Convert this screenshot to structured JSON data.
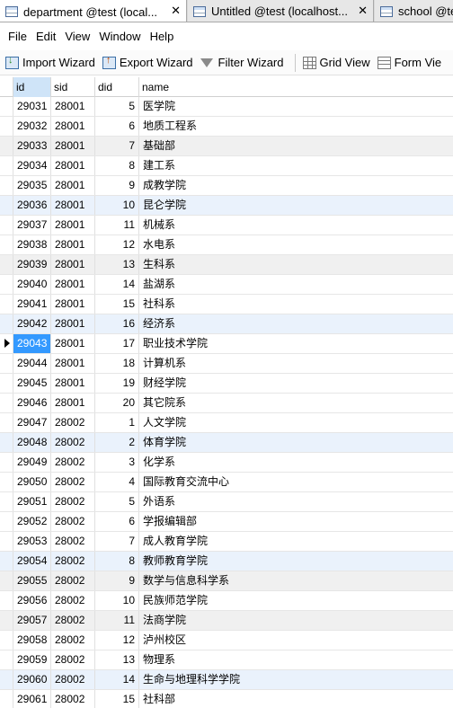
{
  "tabs": [
    {
      "label": "department @test (local...",
      "close": "✕"
    },
    {
      "label": "Untitled @test (localhost...",
      "close": "✕"
    },
    {
      "label": "school @te",
      "close": ""
    }
  ],
  "menu": [
    "File",
    "Edit",
    "View",
    "Window",
    "Help"
  ],
  "toolbar": {
    "import_wizard": "Import Wizard",
    "export_wizard": "Export Wizard",
    "filter_wizard": "Filter Wizard",
    "grid_view": "Grid View",
    "form_view": "Form Vie"
  },
  "columns": [
    "id",
    "sid",
    "did",
    "name"
  ],
  "selected_row_id": "29043",
  "rows": [
    {
      "id": "29031",
      "sid": "28001",
      "did": "5",
      "name": "医学院"
    },
    {
      "id": "29032",
      "sid": "28001",
      "did": "6",
      "name": "地质工程系"
    },
    {
      "id": "29033",
      "sid": "28001",
      "did": "7",
      "name": "基础部"
    },
    {
      "id": "29034",
      "sid": "28001",
      "did": "8",
      "name": "建工系"
    },
    {
      "id": "29035",
      "sid": "28001",
      "did": "9",
      "name": "成教学院"
    },
    {
      "id": "29036",
      "sid": "28001",
      "did": "10",
      "name": "昆仑学院"
    },
    {
      "id": "29037",
      "sid": "28001",
      "did": "11",
      "name": "机械系"
    },
    {
      "id": "29038",
      "sid": "28001",
      "did": "12",
      "name": "水电系"
    },
    {
      "id": "29039",
      "sid": "28001",
      "did": "13",
      "name": "生科系"
    },
    {
      "id": "29040",
      "sid": "28001",
      "did": "14",
      "name": "盐湖系"
    },
    {
      "id": "29041",
      "sid": "28001",
      "did": "15",
      "name": "社科系"
    },
    {
      "id": "29042",
      "sid": "28001",
      "did": "16",
      "name": "经济系"
    },
    {
      "id": "29043",
      "sid": "28001",
      "did": "17",
      "name": "职业技术学院"
    },
    {
      "id": "29044",
      "sid": "28001",
      "did": "18",
      "name": "计算机系"
    },
    {
      "id": "29045",
      "sid": "28001",
      "did": "19",
      "name": "财经学院"
    },
    {
      "id": "29046",
      "sid": "28001",
      "did": "20",
      "name": "其它院系"
    },
    {
      "id": "29047",
      "sid": "28002",
      "did": "1",
      "name": "人文学院"
    },
    {
      "id": "29048",
      "sid": "28002",
      "did": "2",
      "name": "体育学院"
    },
    {
      "id": "29049",
      "sid": "28002",
      "did": "3",
      "name": "化学系"
    },
    {
      "id": "29050",
      "sid": "28002",
      "did": "4",
      "name": "国际教育交流中心"
    },
    {
      "id": "29051",
      "sid": "28002",
      "did": "5",
      "name": "外语系"
    },
    {
      "id": "29052",
      "sid": "28002",
      "did": "6",
      "name": "学报编辑部"
    },
    {
      "id": "29053",
      "sid": "28002",
      "did": "7",
      "name": "成人教育学院"
    },
    {
      "id": "29054",
      "sid": "28002",
      "did": "8",
      "name": "教师教育学院"
    },
    {
      "id": "29055",
      "sid": "28002",
      "did": "9",
      "name": "数学与信息科学系"
    },
    {
      "id": "29056",
      "sid": "28002",
      "did": "10",
      "name": "民族师范学院"
    },
    {
      "id": "29057",
      "sid": "28002",
      "did": "11",
      "name": "法商学院"
    },
    {
      "id": "29058",
      "sid": "28002",
      "did": "12",
      "name": "泸州校区"
    },
    {
      "id": "29059",
      "sid": "28002",
      "did": "13",
      "name": "物理系"
    },
    {
      "id": "29060",
      "sid": "28002",
      "did": "14",
      "name": "生命与地理科学学院"
    },
    {
      "id": "29061",
      "sid": "28002",
      "did": "15",
      "name": "社科部"
    }
  ]
}
